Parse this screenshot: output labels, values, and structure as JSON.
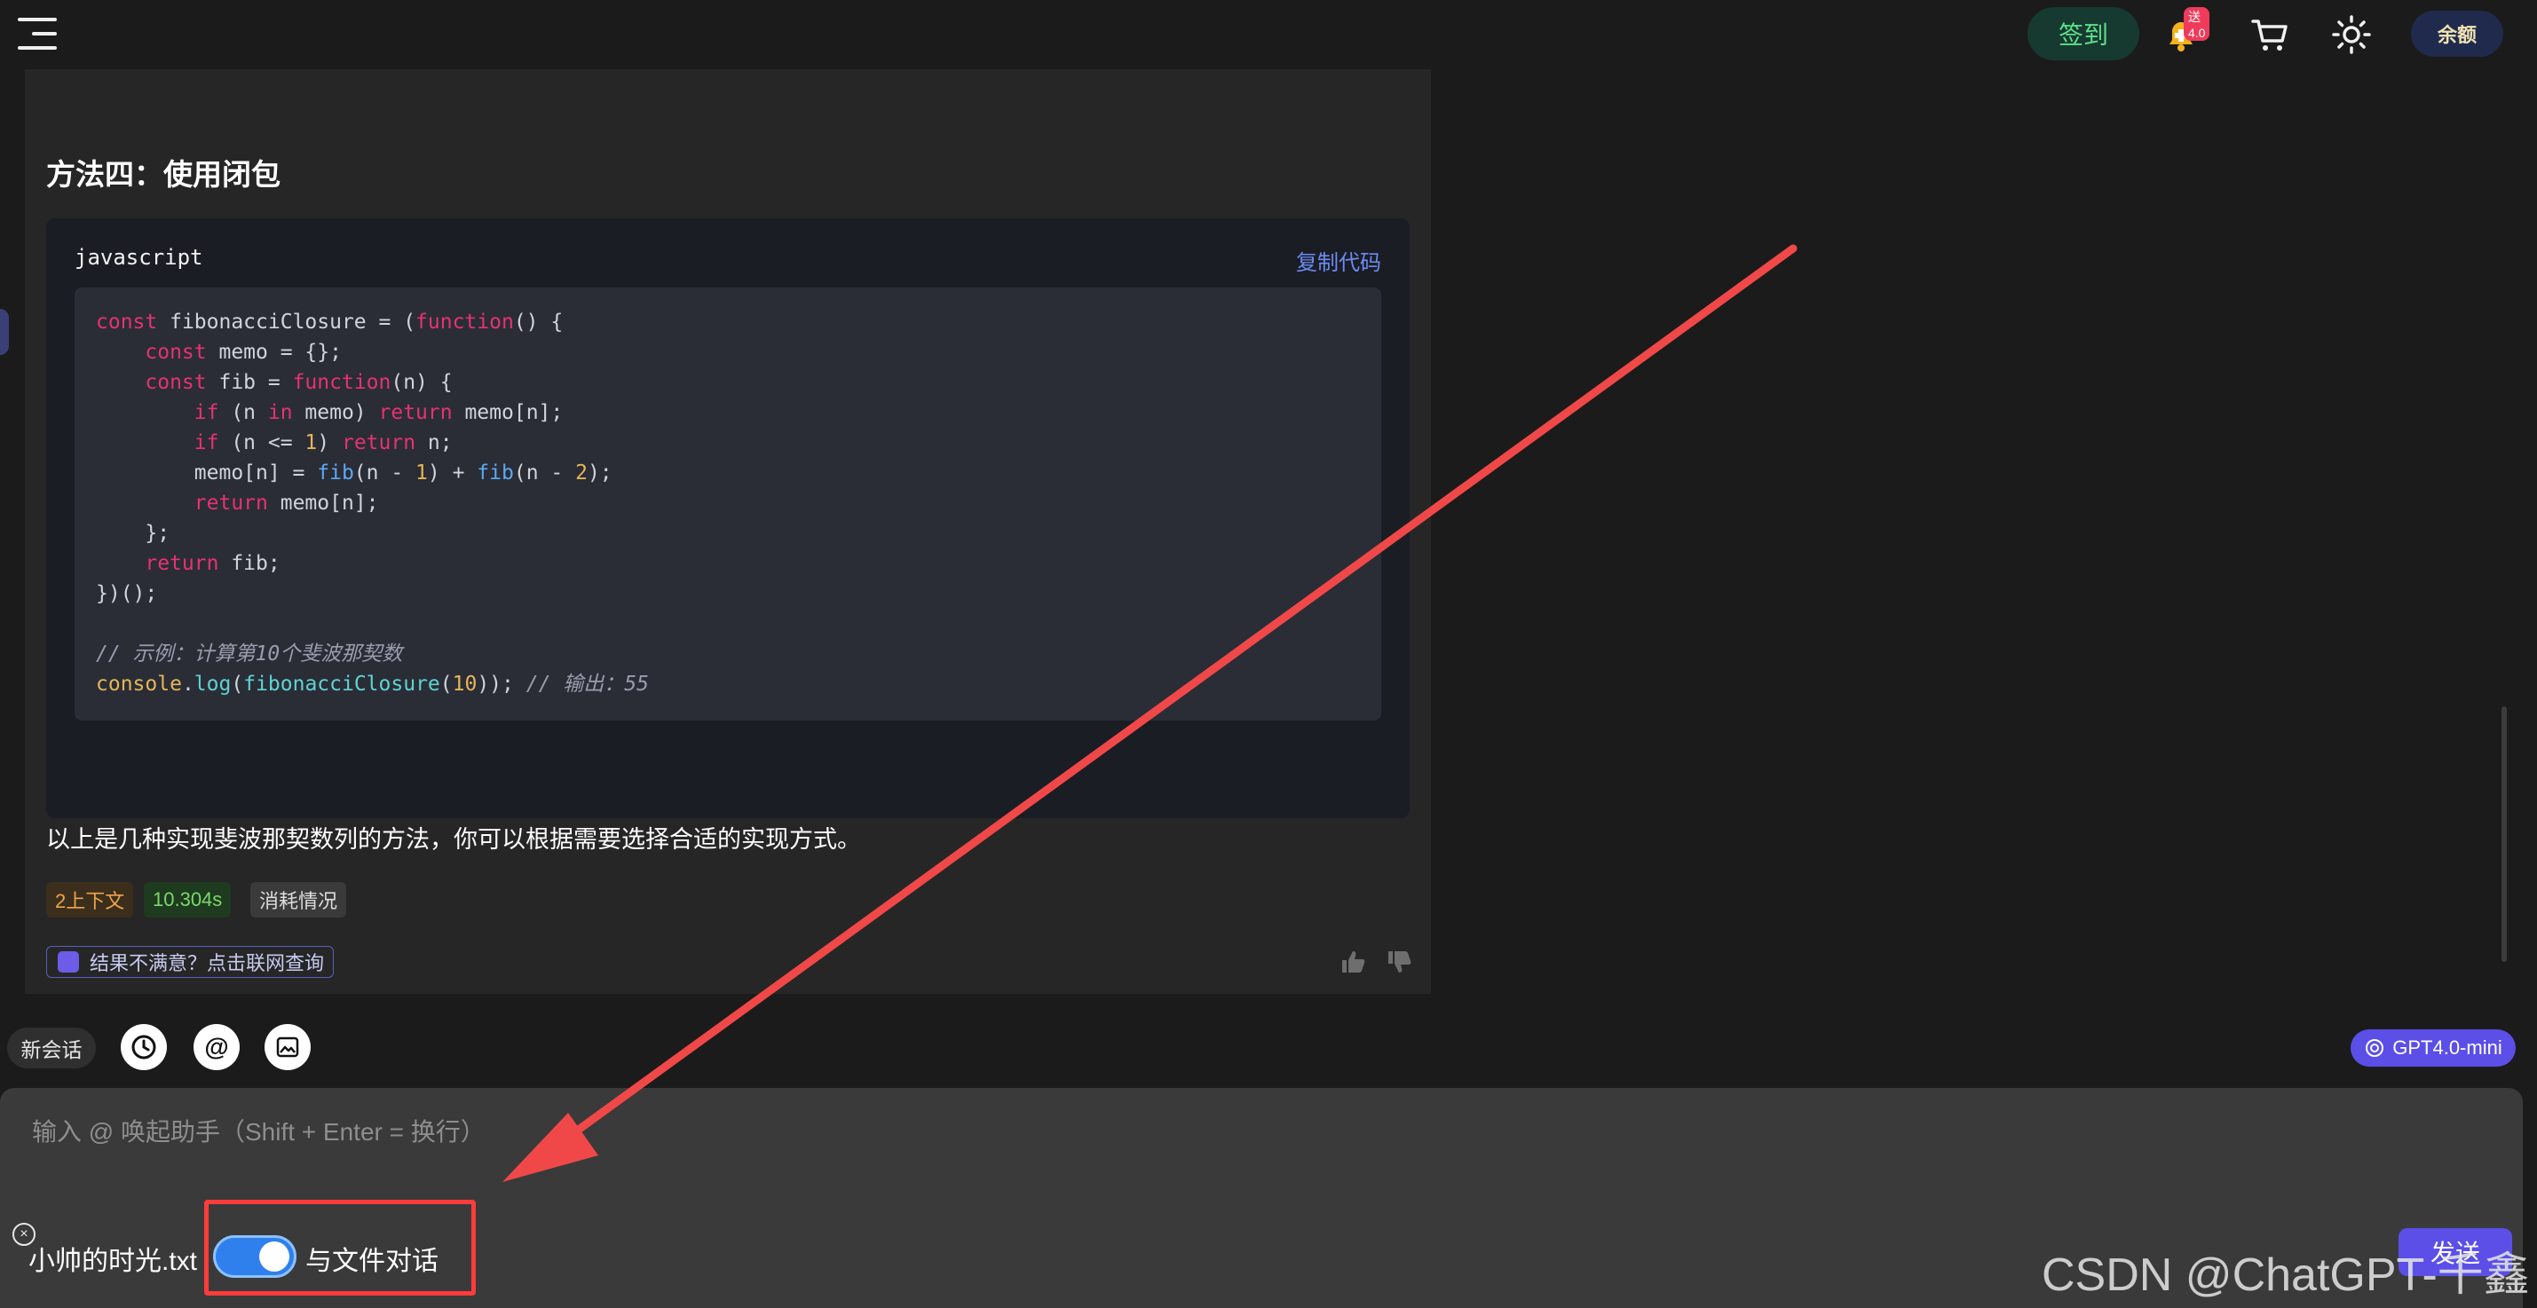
{
  "topbar": {
    "menu_icon": "hamburger-icon",
    "checkin_label": "签到",
    "notification_badge": "送4.0",
    "cart_icon": "cart-icon",
    "theme_icon": "sun-icon",
    "balance_label": "余额"
  },
  "message": {
    "heading": "方法四：使用闭包",
    "code_language": "javascript",
    "copy_label": "复制代码",
    "code_lines": [
      [
        {
          "t": "const ",
          "c": "k"
        },
        {
          "t": "fibonacciClosure = (",
          "c": "o"
        },
        {
          "t": "function",
          "c": "k"
        },
        {
          "t": "() {",
          "c": "o"
        }
      ],
      [
        {
          "t": "    const ",
          "c": "k"
        },
        {
          "t": "memo = {};",
          "c": "o"
        }
      ],
      [
        {
          "t": "    const ",
          "c": "k"
        },
        {
          "t": "fib = ",
          "c": "o"
        },
        {
          "t": "function",
          "c": "k"
        },
        {
          "t": "(n) {",
          "c": "o"
        }
      ],
      [
        {
          "t": "        if ",
          "c": "k"
        },
        {
          "t": "(n ",
          "c": "o"
        },
        {
          "t": "in ",
          "c": "k"
        },
        {
          "t": "memo) ",
          "c": "o"
        },
        {
          "t": "return ",
          "c": "k"
        },
        {
          "t": "memo[n];",
          "c": "o"
        }
      ],
      [
        {
          "t": "        if ",
          "c": "k"
        },
        {
          "t": "(n <= ",
          "c": "o"
        },
        {
          "t": "1",
          "c": "n"
        },
        {
          "t": ") ",
          "c": "o"
        },
        {
          "t": "return ",
          "c": "k"
        },
        {
          "t": "n;",
          "c": "o"
        }
      ],
      [
        {
          "t": "        memo[n] = ",
          "c": "o"
        },
        {
          "t": "fib",
          "c": "f"
        },
        {
          "t": "(n - ",
          "c": "o"
        },
        {
          "t": "1",
          "c": "n"
        },
        {
          "t": ") + ",
          "c": "o"
        },
        {
          "t": "fib",
          "c": "f"
        },
        {
          "t": "(n - ",
          "c": "o"
        },
        {
          "t": "2",
          "c": "n"
        },
        {
          "t": ");",
          "c": "o"
        }
      ],
      [
        {
          "t": "        return ",
          "c": "k"
        },
        {
          "t": "memo[n];",
          "c": "o"
        }
      ],
      [
        {
          "t": "    };",
          "c": "o"
        }
      ],
      [
        {
          "t": "    return ",
          "c": "k"
        },
        {
          "t": "fib;",
          "c": "o"
        }
      ],
      [
        {
          "t": "})();",
          "c": "o"
        }
      ],
      [
        {
          "t": "",
          "c": "o"
        }
      ],
      [
        {
          "t": "// 示例：计算第10个斐波那契数",
          "c": "c"
        }
      ],
      [
        {
          "t": "console",
          "c": "n"
        },
        {
          "t": ".",
          "c": "o"
        },
        {
          "t": "log",
          "c": "lg"
        },
        {
          "t": "(",
          "c": "o"
        },
        {
          "t": "fibonacciClosure",
          "c": "lg"
        },
        {
          "t": "(",
          "c": "o"
        },
        {
          "t": "10",
          "c": "n"
        },
        {
          "t": ")); ",
          "c": "o"
        },
        {
          "t": "// 输出：55",
          "c": "c"
        }
      ]
    ],
    "summary": "以上是几种实现斐波那契数列的方法，你可以根据需要选择合适的实现方式。",
    "tags": {
      "context": "2上下文",
      "time": "10.304s",
      "usage": "消耗情况"
    },
    "web_search_label": "结果不满意？点击联网查询",
    "like_icon": "thumbs-up-icon",
    "dislike_icon": "thumbs-down-icon"
  },
  "toolbar": {
    "new_chat_label": "新会话",
    "history_icon": "history-icon",
    "mention_label": "@",
    "image_icon": "image-icon",
    "model_label": "GPT4.0-mini"
  },
  "composer": {
    "placeholder": "输入 @ 唤起助手（Shift + Enter = 换行）",
    "value": "",
    "file_name": "小帅的时光.txt",
    "file_toggle_label": "与文件对话",
    "file_toggle_on": true,
    "send_label": "发送"
  },
  "watermark": "CSDN @ChatGPT-千鑫",
  "colors": {
    "accent": "#5b4fe8",
    "annotation": "#ff3b3b",
    "toggle_on": "#2f80ed"
  }
}
